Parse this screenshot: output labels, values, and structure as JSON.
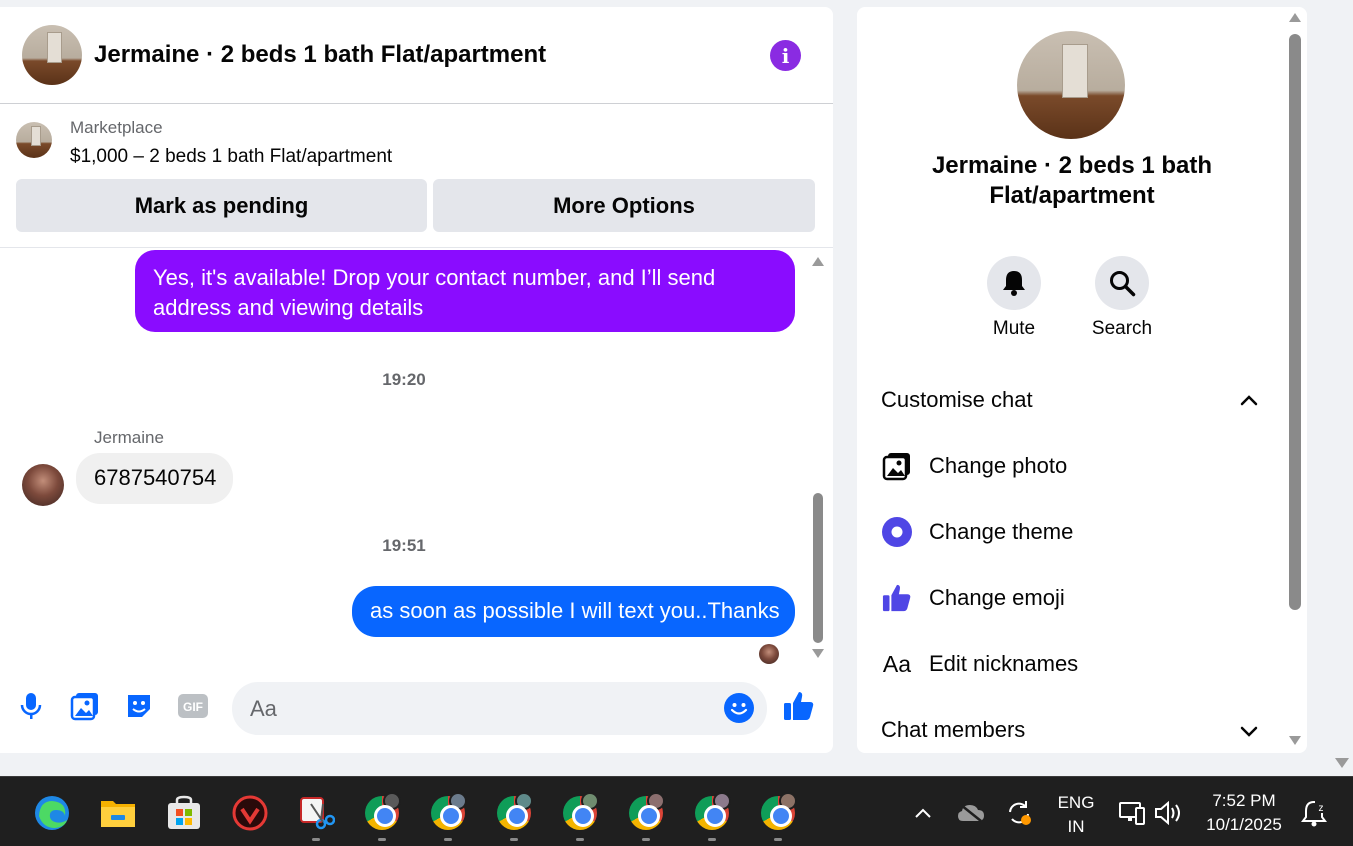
{
  "header": {
    "title": "Jermaine · 2 beds 1 bath Flat/apartment"
  },
  "marketplace": {
    "label": "Marketplace",
    "listing": "$1,000 – 2 beds 1 bath Flat/apartment",
    "pending_button": "Mark as pending",
    "more_button": "More Options"
  },
  "messages": {
    "outgoing_1": "Yes, it's available! Drop your contact number, and I’ll send address and viewing details",
    "time_1": "19:20",
    "sender": "Jermaine",
    "incoming_1": "6787540754",
    "time_2": "19:51",
    "outgoing_2": "as soon as possible I will text you..Thanks"
  },
  "composer": {
    "placeholder": "Aa",
    "gif_label": "GIF"
  },
  "info_panel": {
    "title": "Jermaine · 2 beds 1 bath Flat/apartment",
    "mute_label": "Mute",
    "search_label": "Search",
    "customise_header": "Customise chat",
    "items": [
      {
        "label": "Change photo",
        "icon": "photo-icon"
      },
      {
        "label": "Change theme",
        "icon": "theme-icon"
      },
      {
        "label": "Change emoji",
        "icon": "thumbs-up-icon"
      },
      {
        "label": "Edit nicknames",
        "icon": "text-aa-icon"
      }
    ],
    "members_header": "Chat members",
    "nickname_icon_text": "Aa"
  },
  "taskbar": {
    "language": "ENG",
    "region": "IN",
    "time": "7:52 PM",
    "date": "10/1/2025"
  },
  "colors": {
    "accent_purple": "#8a0cff",
    "messenger_blue": "#0866ff",
    "theme_indigo": "#4f46e5"
  }
}
